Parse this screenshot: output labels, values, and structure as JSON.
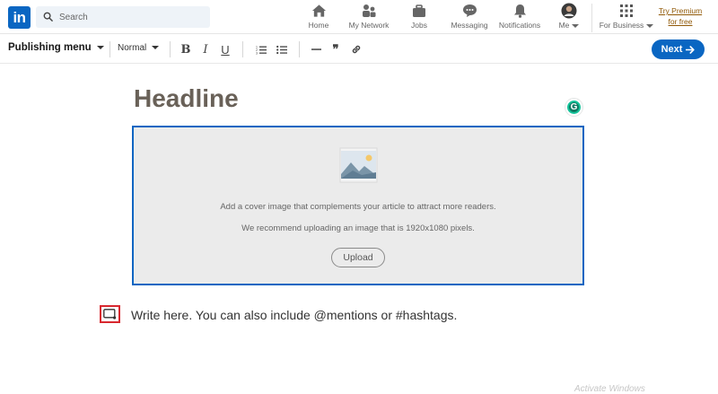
{
  "nav": {
    "logo_text": "in",
    "search_placeholder": "Search",
    "items": [
      {
        "label": "Home",
        "icon": "home-icon"
      },
      {
        "label": "My Network",
        "icon": "network-icon"
      },
      {
        "label": "Jobs",
        "icon": "briefcase-icon"
      },
      {
        "label": "Messaging",
        "icon": "messaging-icon"
      },
      {
        "label": "Notifications",
        "icon": "bell-icon"
      },
      {
        "label": "Me",
        "icon": "avatar"
      }
    ],
    "business_label": "For Business",
    "premium_label": "Try Premium for free"
  },
  "toolbar": {
    "publishing_menu": "Publishing menu",
    "text_style": "Normal",
    "bold_label": "B",
    "italic_label": "I",
    "underline_label": "U",
    "quote_label": "❞",
    "next_label": "Next"
  },
  "editor": {
    "headline_placeholder": "Headline",
    "grammarly_label": "G",
    "cover_line1": "Add a cover image that complements your article to attract more readers.",
    "cover_line2": "We recommend uploading an image that is 1920x1080 pixels.",
    "upload_label": "Upload",
    "body_placeholder": "Write here. You can also include @mentions or #hashtags."
  },
  "watermark": "Activate Windows",
  "colors": {
    "brand_blue": "#0a66c2",
    "highlight_red": "#d8282f",
    "grammarly_green": "#15c39a",
    "premium_gold": "#915907"
  }
}
